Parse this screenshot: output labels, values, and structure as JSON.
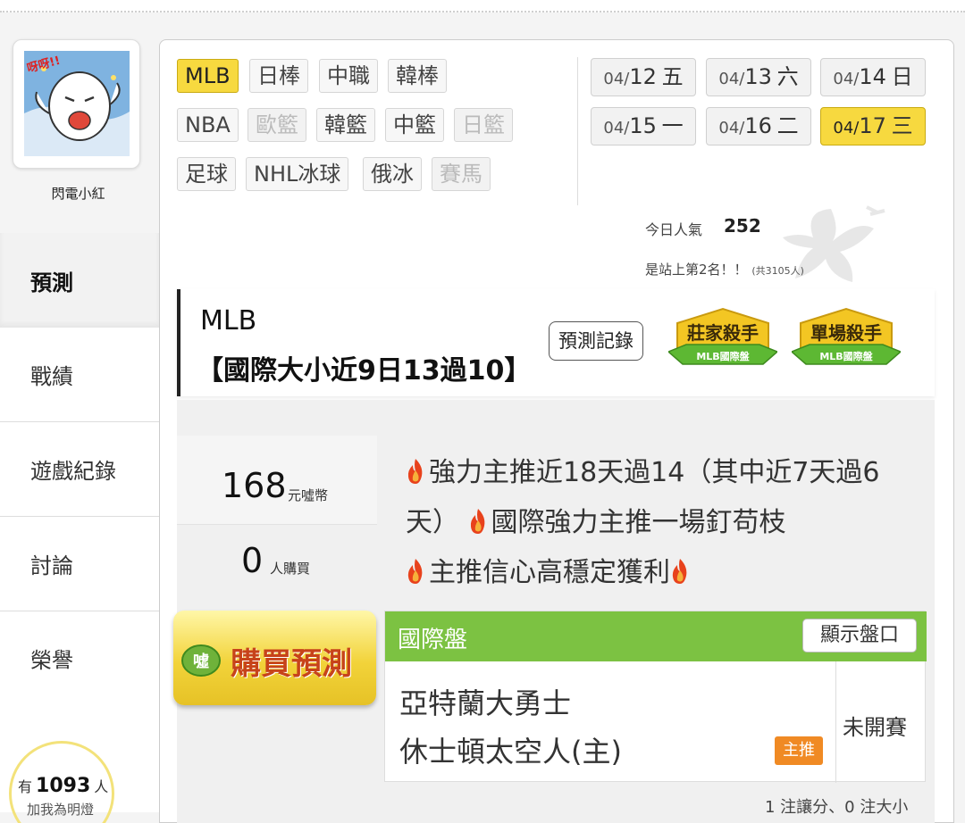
{
  "profile": {
    "name": "閃電小紅",
    "avatar_text": "呀呀!!"
  },
  "nav": {
    "items": [
      {
        "label": "預測",
        "active": true
      },
      {
        "label": "戰績"
      },
      {
        "label": "遊戲紀錄"
      },
      {
        "label": "討論"
      },
      {
        "label": "榮譽"
      }
    ]
  },
  "fans": {
    "prefix": "有",
    "count": "1093",
    "suffix": "人",
    "subtitle": "加我為明燈"
  },
  "sports": [
    {
      "label": "MLB",
      "active": true
    },
    {
      "label": "日棒"
    },
    {
      "label": "中職"
    },
    {
      "label": "韓棒"
    },
    {
      "label": "NBA"
    },
    {
      "label": "歐籃",
      "disabled": true
    },
    {
      "label": "韓籃"
    },
    {
      "label": "中籃"
    },
    {
      "label": "日籃",
      "disabled": true
    },
    {
      "label": "足球"
    },
    {
      "label": "NHL冰球"
    },
    {
      "label": "俄冰"
    },
    {
      "label": "賽馬",
      "disabled": true
    }
  ],
  "dates": [
    {
      "md": "04/",
      "d": "12",
      "w": "五"
    },
    {
      "md": "04/",
      "d": "13",
      "w": "六"
    },
    {
      "md": "04/",
      "d": "14",
      "w": "日"
    },
    {
      "md": "04/",
      "d": "15",
      "w": "一"
    },
    {
      "md": "04/",
      "d": "16",
      "w": "二"
    },
    {
      "md": "04/",
      "d": "17",
      "w": "三",
      "active": true
    }
  ],
  "popularity": {
    "label": "今日人氣",
    "value": "252",
    "rank_text": "是站上第2名！！",
    "rank_total": "(共3105人)"
  },
  "header": {
    "league": "MLB",
    "title": "【國際大小近9日13過10】",
    "record_button": "預測記錄",
    "badges": [
      {
        "title": "莊家殺手",
        "sub": "MLB國際盤"
      },
      {
        "title": "單場殺手",
        "sub": "MLB國際盤"
      }
    ]
  },
  "offer": {
    "price": "168",
    "price_unit": "元噓幣",
    "buyers": "0",
    "buyers_unit": "人購買",
    "desc1": "強力主推近18天過14（其中近7天過6天）",
    "desc2": "國際強力主推一場釘苟枝",
    "desc3": "主推信心高穩定獲利",
    "buy_label": "購買預測",
    "buy_icon_text": "噓"
  },
  "market": {
    "title": "國際盤",
    "show_button": "顯示盤口",
    "team1": "亞特蘭大勇士",
    "team2": "休士頓太空人(主)",
    "tag": "主推",
    "status": "未開賽",
    "summary": "1 注讓分、0 注大小"
  },
  "colors": {
    "accent_yellow": "#f7d93f",
    "market_green": "#7cc242",
    "tag_orange": "#f08a24",
    "buy_text": "#c7431a"
  }
}
